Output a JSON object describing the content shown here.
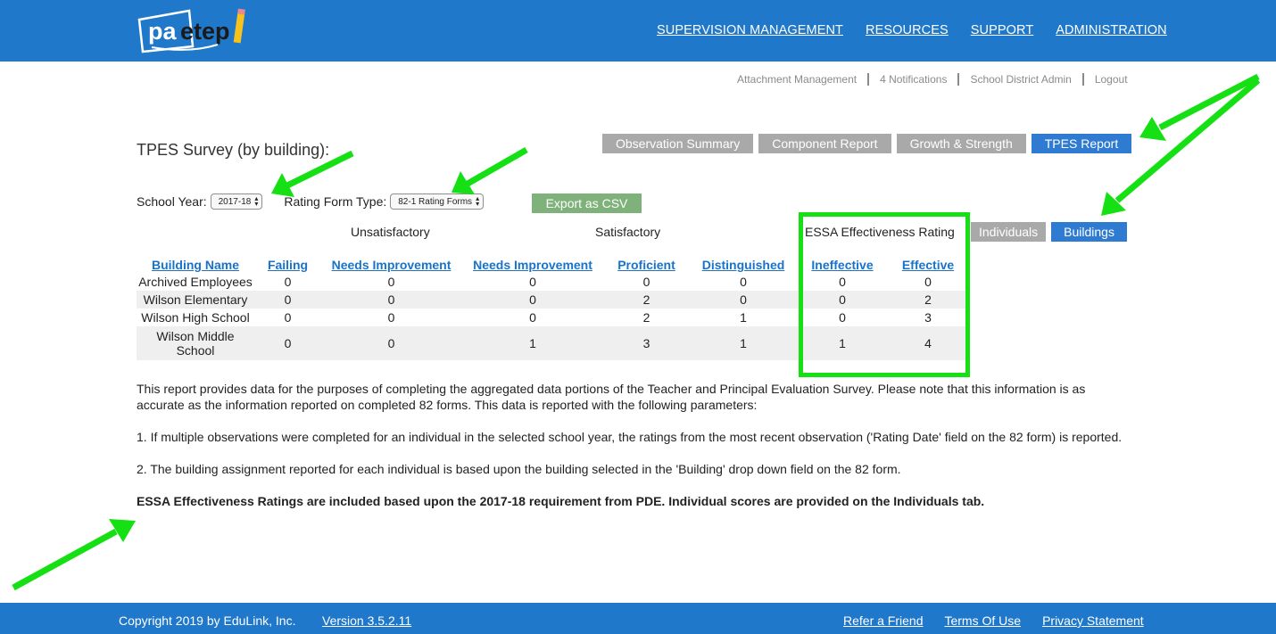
{
  "header": {
    "logo_text": "paetep",
    "nav": [
      "SUPERVISION MANAGEMENT",
      "RESOURCES",
      "SUPPORT",
      "ADMINISTRATION"
    ]
  },
  "utility_nav": [
    "Attachment Management",
    "4 Notifications",
    "School District Admin",
    "Logout"
  ],
  "page_title": "TPES Survey (by building):",
  "report_tabs": [
    {
      "label": "Observation Summary",
      "active": false
    },
    {
      "label": "Component Report",
      "active": false
    },
    {
      "label": "Growth & Strength",
      "active": false
    },
    {
      "label": "TPES Report",
      "active": true
    }
  ],
  "filters": {
    "school_year_label": "School Year:",
    "school_year_value": "2017-18",
    "rating_form_label": "Rating Form Type:",
    "rating_form_value": "82-1 Rating Forms",
    "export_label": "Export as CSV"
  },
  "view_tabs": [
    {
      "label": "Individuals",
      "active": false
    },
    {
      "label": "Buildings",
      "active": true
    }
  ],
  "groups": {
    "unsatisfactory": "Unsatisfactory",
    "satisfactory": "Satisfactory",
    "essa": "ESSA Effectiveness Rating"
  },
  "table": {
    "columns": [
      "Building Name",
      "Failing",
      "Needs Improvement",
      "Needs Improvement",
      "Proficient",
      "Distinguished",
      "Ineffective",
      "Effective"
    ],
    "rows": [
      [
        "Archived Employees",
        "0",
        "0",
        "0",
        "0",
        "0",
        "0",
        "0"
      ],
      [
        "Wilson Elementary",
        "0",
        "0",
        "0",
        "2",
        "0",
        "0",
        "2"
      ],
      [
        "Wilson High School",
        "0",
        "0",
        "0",
        "2",
        "1",
        "0",
        "3"
      ],
      [
        "Wilson Middle School",
        "0",
        "0",
        "1",
        "3",
        "1",
        "1",
        "4"
      ]
    ]
  },
  "description": [
    "This report provides data for the purposes of completing the aggregated data portions of the Teacher and Principal Evaluation Survey. Please note that this information is as accurate as the information reported on completed 82 forms. This data is reported with the following parameters:",
    "1. If multiple observations were completed for an individual in the selected school year, the ratings from the most recent observation ('Rating Date' field on the 82 form) is reported.",
    "2. The building assignment reported for each individual is based upon the building selected in the 'Building' drop down field on the 82 form.",
    "ESSA Effectiveness Ratings are included based upon the 2017-18 requirement from PDE. Individual scores are provided on the Individuals tab."
  ],
  "footer": {
    "copyright": "Copyright 2019 by EduLink, Inc.",
    "version": "Version 3.5.2.11",
    "links": [
      "Refer a Friend",
      "Terms Of Use",
      "Privacy Statement"
    ]
  },
  "colors": {
    "brand_blue": "#1f78c9",
    "active_tab": "#2f7bd1",
    "inactive_tab": "#a9a9a9",
    "export_green": "#7fb27a",
    "annotation_green": "#14e014",
    "link_blue": "#1a73c9"
  }
}
